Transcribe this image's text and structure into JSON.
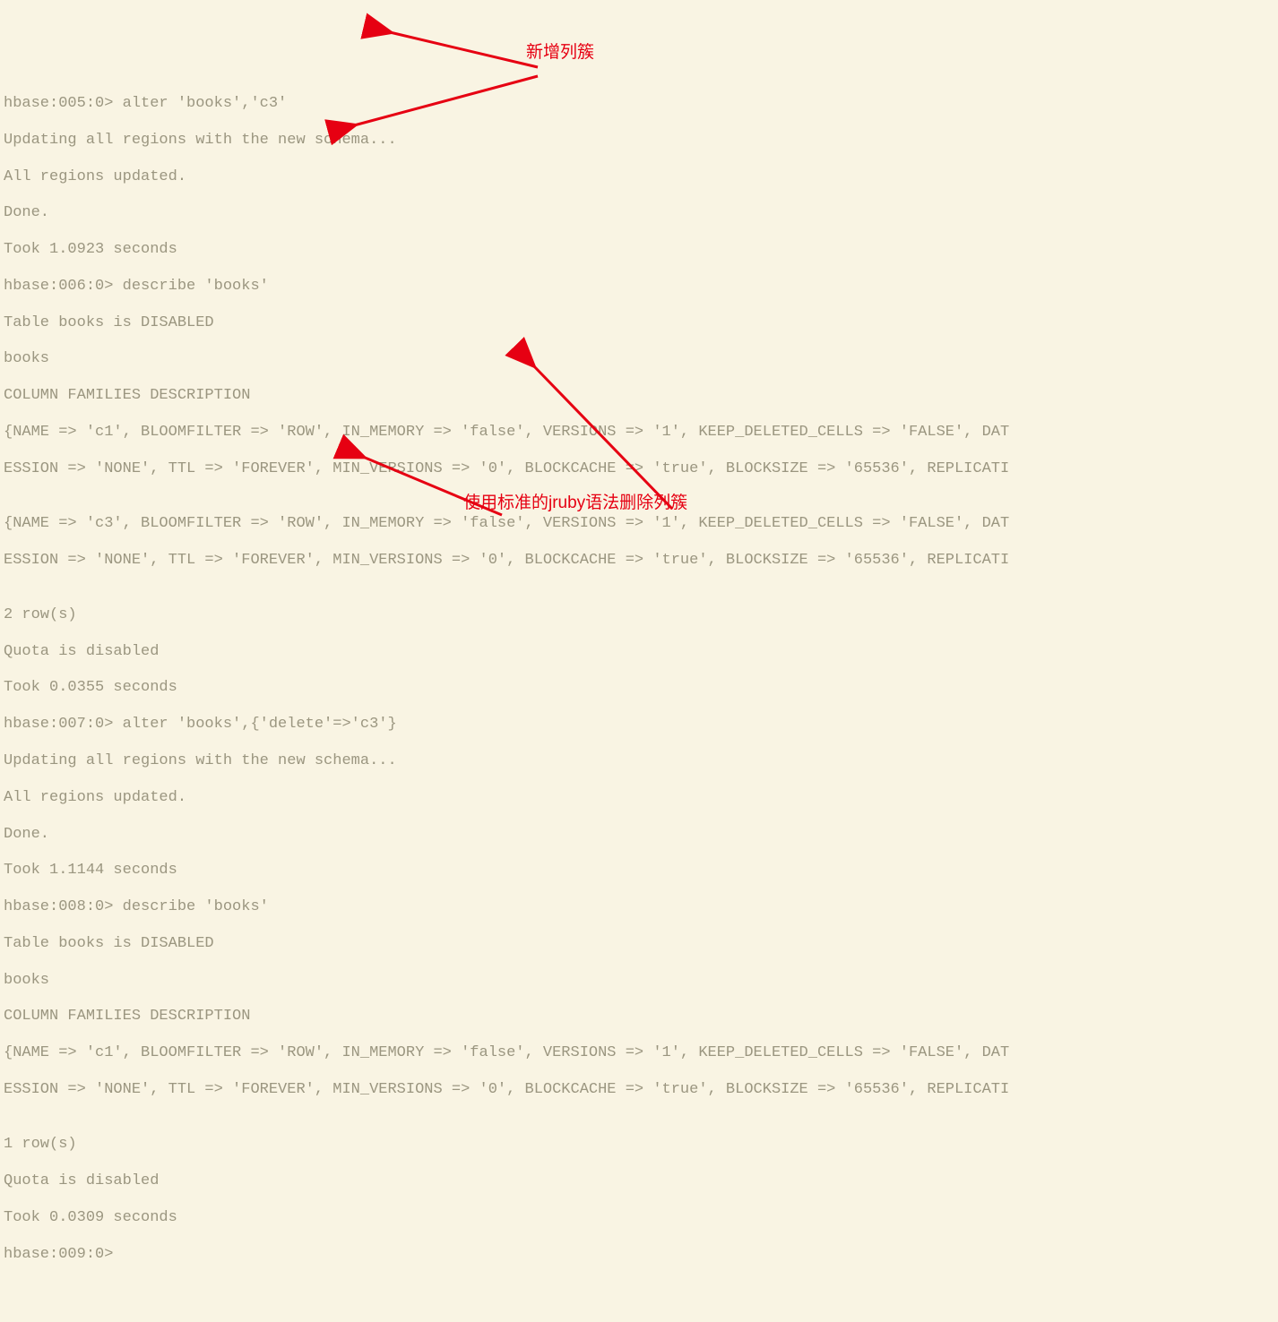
{
  "terminal": {
    "lines": [
      "hbase:005:0> alter 'books','c3'",
      "Updating all regions with the new schema...",
      "All regions updated.",
      "Done.",
      "Took 1.0923 seconds",
      "hbase:006:0> describe 'books'",
      "Table books is DISABLED",
      "books",
      "COLUMN FAMILIES DESCRIPTION",
      "{NAME => 'c1', BLOOMFILTER => 'ROW', IN_MEMORY => 'false', VERSIONS => '1', KEEP_DELETED_CELLS => 'FALSE', DAT",
      "ESSION => 'NONE', TTL => 'FOREVER', MIN_VERSIONS => '0', BLOCKCACHE => 'true', BLOCKSIZE => '65536', REPLICATI",
      "",
      "{NAME => 'c3', BLOOMFILTER => 'ROW', IN_MEMORY => 'false', VERSIONS => '1', KEEP_DELETED_CELLS => 'FALSE', DAT",
      "ESSION => 'NONE', TTL => 'FOREVER', MIN_VERSIONS => '0', BLOCKCACHE => 'true', BLOCKSIZE => '65536', REPLICATI",
      "",
      "2 row(s)",
      "Quota is disabled",
      "Took 0.0355 seconds",
      "hbase:007:0> alter 'books',{'delete'=>'c3'}",
      "Updating all regions with the new schema...",
      "All regions updated.",
      "Done.",
      "Took 1.1144 seconds",
      "hbase:008:0> describe 'books'",
      "Table books is DISABLED",
      "books",
      "COLUMN FAMILIES DESCRIPTION",
      "{NAME => 'c1', BLOOMFILTER => 'ROW', IN_MEMORY => 'false', VERSIONS => '1', KEEP_DELETED_CELLS => 'FALSE', DAT",
      "ESSION => 'NONE', TTL => 'FOREVER', MIN_VERSIONS => '0', BLOCKCACHE => 'true', BLOCKSIZE => '65536', REPLICATI",
      "",
      "1 row(s)",
      "Quota is disabled",
      "Took 0.0309 seconds",
      "hbase:009:0>"
    ]
  },
  "annotations": {
    "note1": "新增列簇",
    "note2": "使用标准的jruby语法删除列簇"
  }
}
